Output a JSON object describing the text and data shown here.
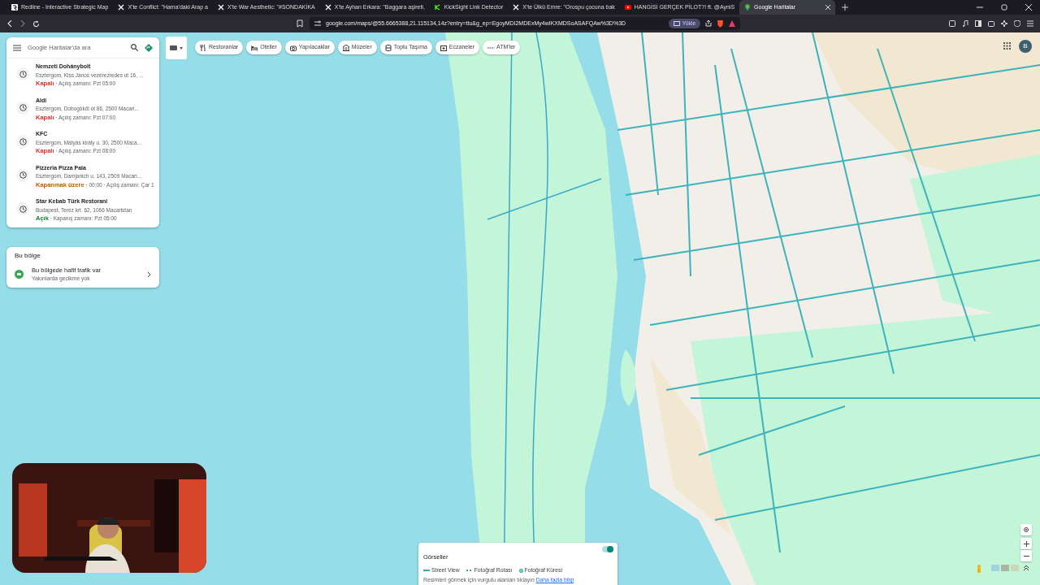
{
  "browser": {
    "tabs": [
      {
        "title": "Redline - Interactive Strategic Map",
        "selected": false
      },
      {
        "title": "X'te Conflict: \"Hama'daki Arap a",
        "selected": false
      },
      {
        "title": "X'te War Aesthetic: \"#SONDAKİKA",
        "selected": false
      },
      {
        "title": "X'te Ayhan Erkara: \"Baggara aşireti,",
        "selected": false
      },
      {
        "title": "KickSight Link Detector",
        "selected": false
      },
      {
        "title": "X'te Ülkü Emre: \"Orospu çocuna bak",
        "selected": false
      },
      {
        "title": "HANGİSİ GERÇEK PİLOT?! ft. @AyniS",
        "selected": false
      },
      {
        "title": "Google Haritalar",
        "selected": true
      }
    ],
    "url": "google.com/maps/@55.6665388,21.115134,14z?entry=ttu&g_ep=EgoyMDI2MDExMy4wIKXMDSoASAFQAw%3D%3D",
    "install_label": "Yükle"
  },
  "maps": {
    "search": {
      "placeholder": "Google Haritalar'da ara"
    },
    "recent": [
      {
        "name": "Nemzeti Dohánybolt",
        "address": "Esztergom, Kiss János vezérezredes út 16, ...",
        "status": "Kapalı",
        "color": "#d93025",
        "hours": "· Açılış zamanı: Pzt 05:00"
      },
      {
        "name": "Aldi",
        "address": "Esztergom, Dobogókői út 86, 2500 Macari...",
        "status": "Kapalı",
        "color": "#d93025",
        "hours": "· Açılış zamanı: Pzt 07:00"
      },
      {
        "name": "KFC",
        "address": "Esztergom, Mátyás király u. 30, 2500 Maca...",
        "status": "Kapalı",
        "color": "#d93025",
        "hours": "· Açılış zamanı: Pzt 08:00"
      },
      {
        "name": "Pizzeria Pizza Pala",
        "address": "Esztergom, Damjanich u. 143, 2509 Macari...",
        "status": "Kapanmak üzere",
        "color": "#b06000",
        "hours": "· 00:00 · Açılış zamanı: Çar 1"
      },
      {
        "name": "Star Kebab Türk Restorani",
        "address": "Budapest, Teréz krt. 62, 1066 Macaristan",
        "status": "Açık",
        "color": "#188038",
        "hours": "· Kapanış zamanı: Pzt 05:00"
      }
    ],
    "region": {
      "title": "Bu bölge",
      "text": "Bu bölgede hafif trafik var",
      "subtext": "Yakınlarda gecikme yok"
    },
    "chips": [
      "Restoranlar",
      "Oteller",
      "Yapılacaklar",
      "Müzeler",
      "Toplu Taşıma",
      "Eczaneler",
      "ATM'ler"
    ],
    "avatar": "B",
    "layers": {
      "title": "Görseller",
      "on": true,
      "legend": [
        {
          "label": "Street View",
          "kind": "line"
        },
        {
          "label": "Fotoğraf Rotası",
          "kind": "dotted"
        },
        {
          "label": "Fotoğraf Küresi",
          "kind": "dot"
        }
      ],
      "hint": "Resimleri görmek için vurgulu alanları tıklayın",
      "link": "Daha fazla bilgi"
    }
  }
}
